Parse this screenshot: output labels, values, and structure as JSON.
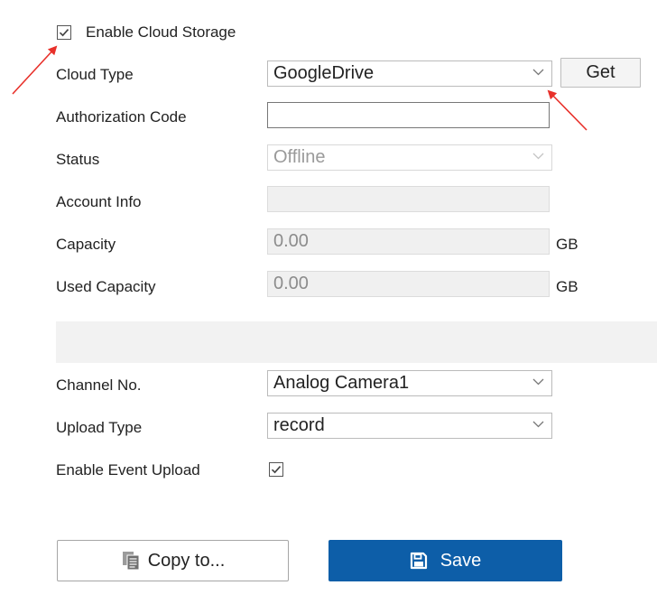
{
  "form": {
    "enable_cloud_storage": {
      "label": "Enable Cloud Storage",
      "checked": true
    },
    "cloud_type": {
      "label": "Cloud Type",
      "value": "GoogleDrive",
      "get_label": "Get"
    },
    "authorization_code": {
      "label": "Authorization Code",
      "value": ""
    },
    "status": {
      "label": "Status",
      "value": "Offline"
    },
    "account_info": {
      "label": "Account Info",
      "value": ""
    },
    "capacity": {
      "label": "Capacity",
      "value": "0.00",
      "unit": "GB"
    },
    "used_capacity": {
      "label": "Used Capacity",
      "value": "0.00",
      "unit": "GB"
    },
    "channel_no": {
      "label": "Channel No.",
      "value": "Analog Camera1"
    },
    "upload_type": {
      "label": "Upload Type",
      "value": "record"
    },
    "enable_event_upload": {
      "label": "Enable Event Upload",
      "checked": true
    }
  },
  "buttons": {
    "copy_to": "Copy to...",
    "save": "Save"
  },
  "icons": {
    "checkbox": "check-icon",
    "dropdown": "chevron-down-icon",
    "copy": "copy-icon",
    "save": "floppy-disk-icon"
  },
  "colors": {
    "primary": "#0d5ea8",
    "annotation_arrow": "#e8302a",
    "readonly_bg": "#f0f0f0"
  }
}
